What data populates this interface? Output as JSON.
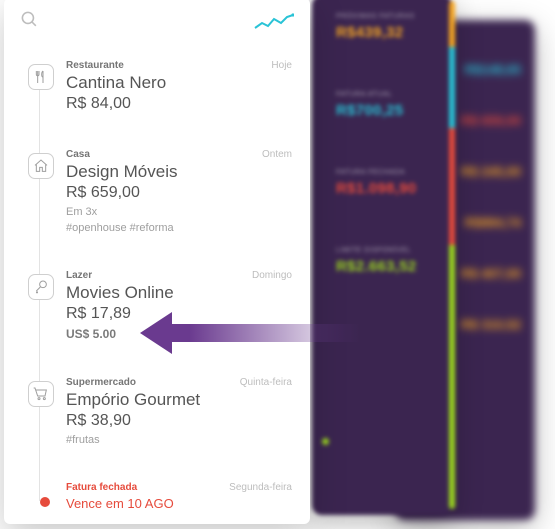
{
  "mid": {
    "items": [
      {
        "label": "PRÓXIMAS FATURAS",
        "value": "R$439,32",
        "color": "#f5a623"
      },
      {
        "label": "FATURA ATUAL",
        "value": "R$700,25",
        "color": "#29c3d6"
      },
      {
        "label": "FATURA FECHADA",
        "value": "R$1.098,90",
        "color": "#e64b3c"
      },
      {
        "label": "LIMITE DISPONÍVEL",
        "value": "R$2.663,52",
        "color": "#9ad61f"
      }
    ],
    "bar": [
      {
        "color": "#f5a623",
        "h": 9
      },
      {
        "color": "#29c3d6",
        "h": 16
      },
      {
        "color": "#e64b3c",
        "h": 23
      },
      {
        "color": "#9ad61f",
        "h": 52
      }
    ]
  },
  "back": {
    "rows": [
      {
        "value": "R$148,65",
        "color": "#29c3d6"
      },
      {
        "value": "R$ 659,00",
        "color": "#e64b3c"
      },
      {
        "value": "R$ 245,00",
        "color": "#f5a623"
      },
      {
        "value": "R$884,74",
        "color": "#f5a623"
      },
      {
        "value": "R$ 407,00",
        "color": "#f5a623"
      },
      {
        "value": "R$ 310,52",
        "color": "#f5a623"
      }
    ]
  },
  "feed": [
    {
      "icon": "fork-knife",
      "category": "Restaurante",
      "title": "Cantina Nero",
      "amount": "R$ 84,00",
      "day": "Hoje"
    },
    {
      "icon": "home",
      "category": "Casa",
      "title": "Design Móveis",
      "amount": "R$ 659,00",
      "day": "Ontem",
      "meta": "Em 3x",
      "tags": "#openhouse  #reforma"
    },
    {
      "icon": "racquet",
      "category": "Lazer",
      "title": "Movies Online",
      "amount": "R$ 17,89",
      "day": "Domingo",
      "usd": "US$ 5.00"
    },
    {
      "icon": "cart",
      "category": "Supermercado",
      "title": "Empório Gourmet",
      "amount": "R$ 38,90",
      "day": "Quinta-feira",
      "tags": "#frutas"
    }
  ],
  "closed": {
    "category": "Fatura fechada",
    "title": "Vence em 10 AGO",
    "day": "Segunda-feira"
  }
}
